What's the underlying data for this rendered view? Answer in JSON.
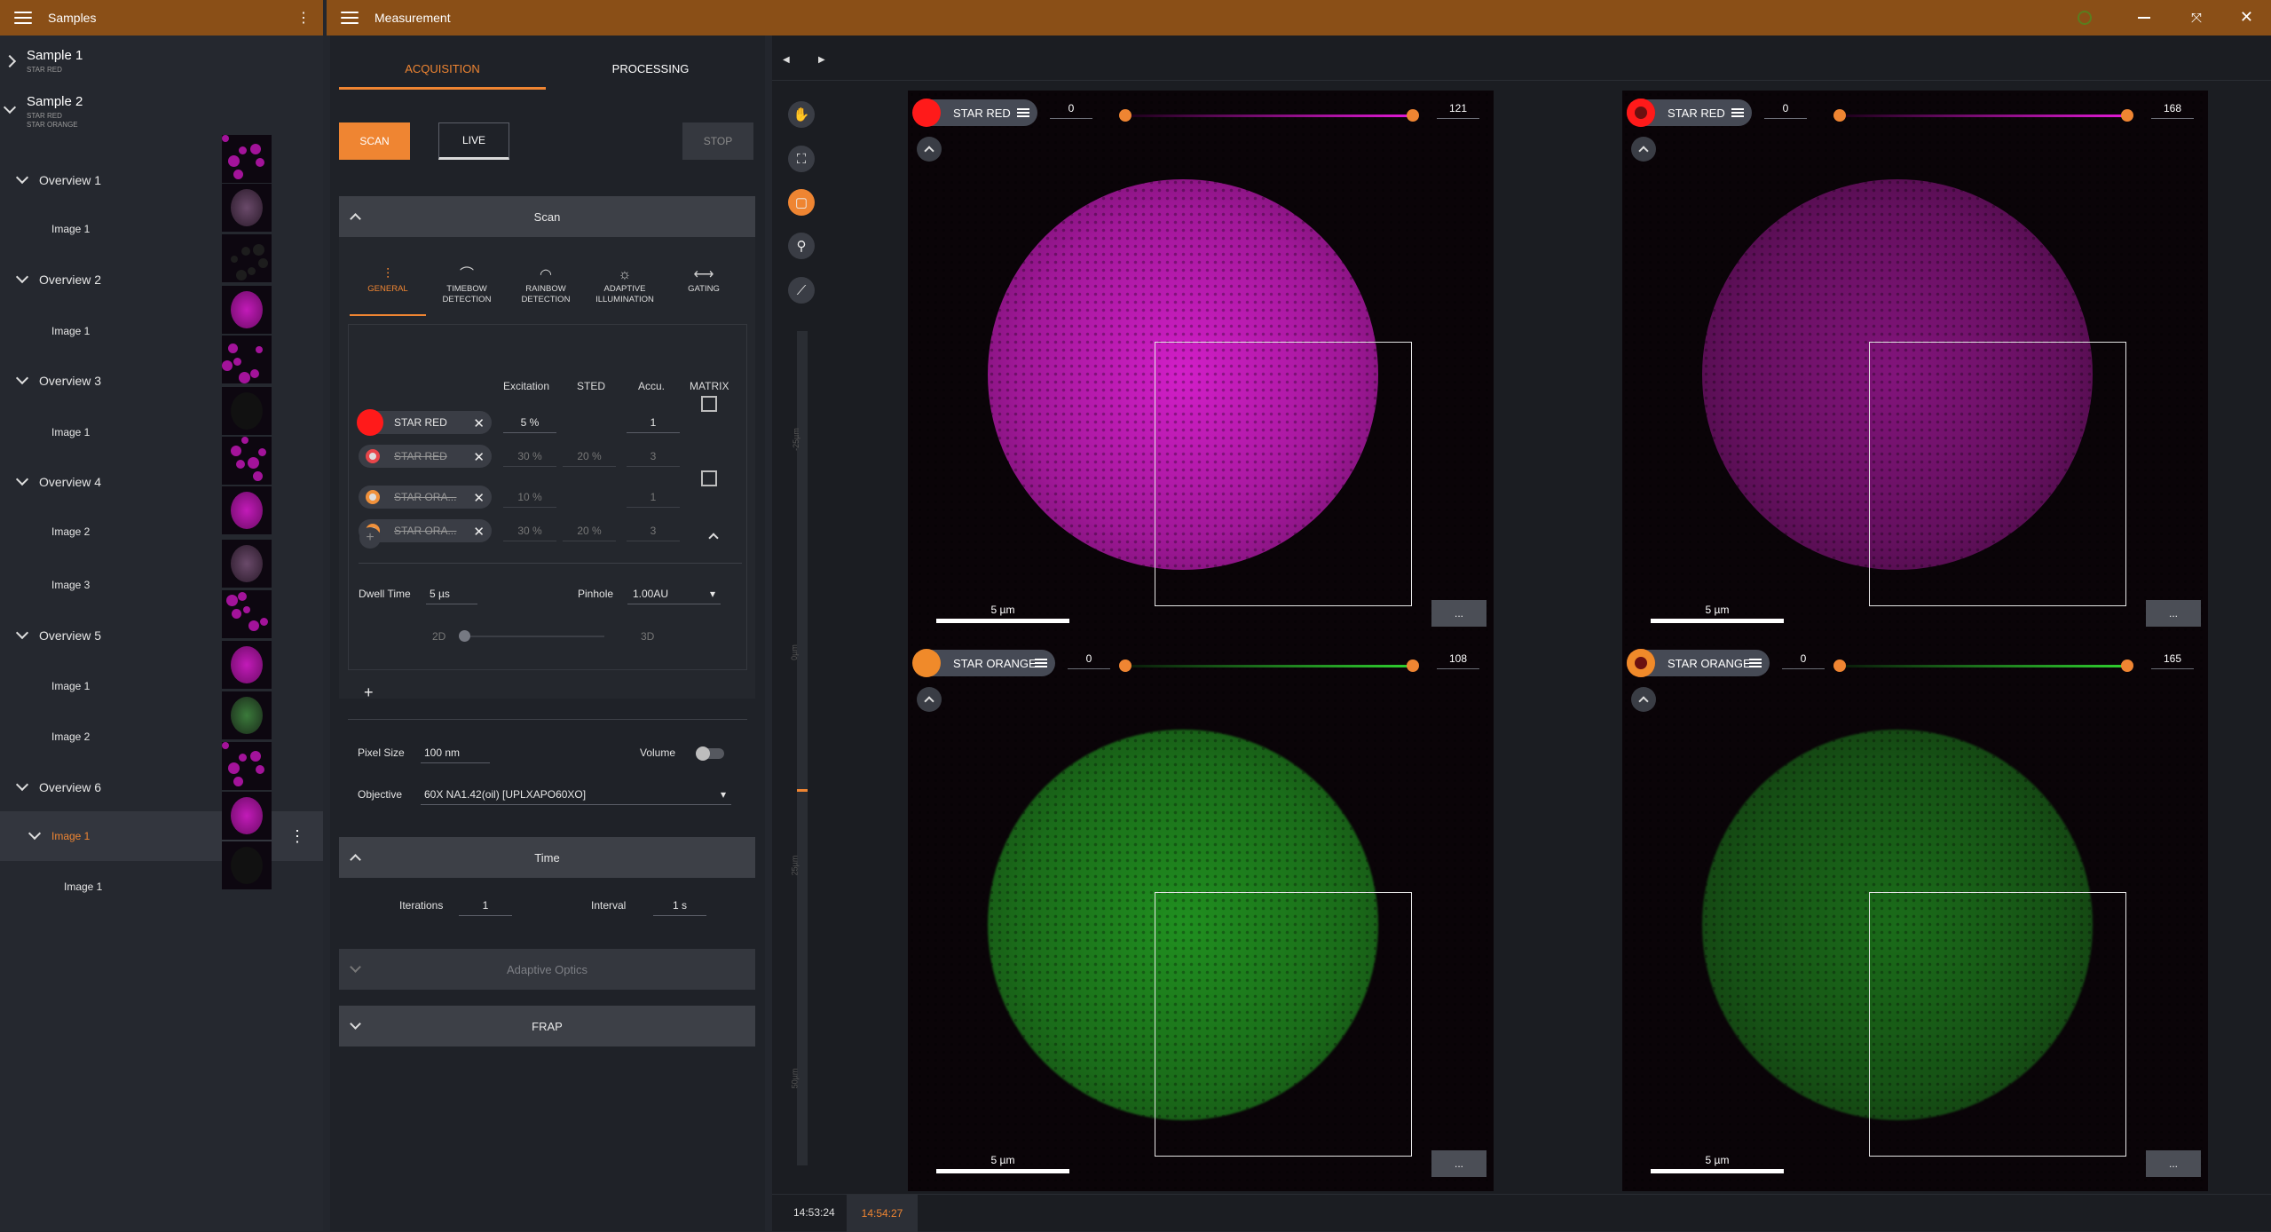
{
  "left_window": {
    "title": "Samples"
  },
  "main_window": {
    "title": "Measurement"
  },
  "samples": [
    {
      "name": "Sample 1",
      "dyes": [
        "STAR RED"
      ]
    },
    {
      "name": "Sample 2",
      "dyes": [
        "STAR RED",
        "STAR ORANGE"
      ]
    }
  ],
  "tree": [
    {
      "label": "Overview 1",
      "kind": "overview"
    },
    {
      "label": "Image 1",
      "kind": "image"
    },
    {
      "label": "Overview 2",
      "kind": "overview"
    },
    {
      "label": "Image 1",
      "kind": "image"
    },
    {
      "label": "Overview 3",
      "kind": "overview"
    },
    {
      "label": "Image 1",
      "kind": "image"
    },
    {
      "label": "Overview 4",
      "kind": "overview"
    },
    {
      "label": "Image 2",
      "kind": "image"
    },
    {
      "label": "Image 3",
      "kind": "image"
    },
    {
      "label": "Overview 5",
      "kind": "overview"
    },
    {
      "label": "Image 1",
      "kind": "image"
    },
    {
      "label": "Image 2",
      "kind": "image"
    },
    {
      "label": "Overview 6",
      "kind": "overview"
    },
    {
      "label": "Image 1",
      "kind": "image-selected"
    },
    {
      "label": "Image 1",
      "kind": "subimage"
    }
  ],
  "tabs": {
    "acquisition": "ACQUISITION",
    "processing": "PROCESSING"
  },
  "actions": {
    "scan": "SCAN",
    "live": "LIVE",
    "stop": "STOP"
  },
  "scan_panel": {
    "title": "Scan",
    "detector_tabs": [
      {
        "label": "GENERAL",
        "icon": "sliders-icon"
      },
      {
        "label": "TIMEBOW DETECTION",
        "icon": "timebow-icon"
      },
      {
        "label": "RAINBOW DETECTION",
        "icon": "rainbow-icon"
      },
      {
        "label": "ADAPTIVE ILLUMINATION",
        "icon": "sun-icon"
      },
      {
        "label": "GATING",
        "icon": "gating-icon"
      }
    ],
    "columns": {
      "excitation": "Excitation",
      "sted": "STED",
      "accu": "Accu.",
      "matrix": "MATRIX"
    },
    "channels": [
      {
        "name": "STAR RED",
        "excitation": "5 %",
        "sted": "",
        "accu": "1",
        "enabled": true,
        "color": "#ff1a1a"
      },
      {
        "name": "STAR RED",
        "excitation": "30 %",
        "sted": "20 %",
        "accu": "3",
        "enabled": false,
        "color": "#e8464a"
      },
      {
        "name": "STAR ORA...",
        "excitation": "10 %",
        "sted": "",
        "accu": "1",
        "enabled": false,
        "color": "#f0913b"
      },
      {
        "name": "STAR ORA...",
        "excitation": "30 %",
        "sted": "20 %",
        "accu": "3",
        "enabled": false,
        "color": "#f0913b"
      }
    ],
    "dwell_time_label": "Dwell Time",
    "dwell_time": "5 µs",
    "pinhole_label": "Pinhole",
    "pinhole": "1.00AU",
    "mode_2d": "2D",
    "mode_3d": "3D",
    "add": "+",
    "pixel_size_label": "Pixel Size",
    "pixel_size": "100 nm",
    "volume_label": "Volume",
    "objective_label": "Objective",
    "objective": "60X NA1.42(oil) [UPLXAPO60XO]"
  },
  "time_panel": {
    "title": "Time",
    "iterations_label": "Iterations",
    "iterations": "1",
    "interval_label": "Interval",
    "interval": "1 s"
  },
  "adaptive_optics_panel": {
    "title": "Adaptive Optics"
  },
  "frap_panel": {
    "title": "FRAP"
  },
  "tools": [
    "pan-icon",
    "crop-icon",
    "layers-icon",
    "zoom-icon",
    "profile-icon"
  ],
  "z_axis": {
    "labels": [
      "-25µm",
      "0µm",
      "25µm",
      "50µm"
    ]
  },
  "timeline": {
    "t1": "14:53:24",
    "t2": "14:54:27"
  },
  "viewers": [
    {
      "channel": "STAR RED",
      "min": "0",
      "max": "121",
      "scale": "5 µm",
      "color": "#ff1a1a",
      "lut": "magenta",
      "intensity": 1.0
    },
    {
      "channel": "STAR RED",
      "min": "0",
      "max": "168",
      "scale": "5 µm",
      "color": "#ff1a1a",
      "lut": "magenta",
      "intensity": 0.6
    },
    {
      "channel": "STAR ORANGE",
      "min": "0",
      "max": "108",
      "scale": "5 µm",
      "color": "#f08a2a",
      "lut": "green",
      "intensity": 1.0
    },
    {
      "channel": "STAR ORANGE",
      "min": "0",
      "max": "165",
      "scale": "5 µm",
      "color": "#f08a2a",
      "lut": "green",
      "intensity": 0.75
    }
  ],
  "more_label": "..."
}
